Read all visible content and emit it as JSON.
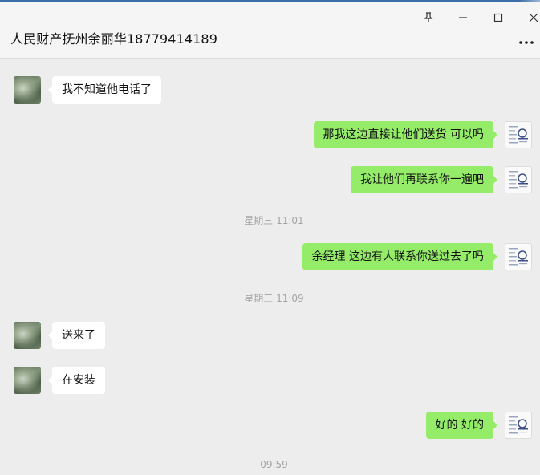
{
  "window": {
    "title": "人民财产抚州余丽华18779414189",
    "pin_icon": "pin-icon",
    "minimize_icon": "minimize-icon",
    "maximize_icon": "maximize-icon",
    "close_icon": "close-icon",
    "more_icon": "more-dots-icon"
  },
  "colors": {
    "outgoing_bubble": "#95ec69",
    "incoming_bubble": "#ffffff",
    "background": "#ededed",
    "timestamp": "#a3a3a3"
  },
  "messages": [
    {
      "direction": "in",
      "text": "我不知道他电话了"
    },
    {
      "direction": "out",
      "text": "那我这边直接让他们送货 可以吗"
    },
    {
      "direction": "out",
      "text": "我让他们再联系你一遍吧"
    },
    {
      "type": "time",
      "text": "星期三 11:01"
    },
    {
      "direction": "out",
      "text": "余经理  这边有人联系你送过去了吗"
    },
    {
      "type": "time",
      "text": "星期三 11:09"
    },
    {
      "direction": "in",
      "text": "送来了"
    },
    {
      "direction": "in",
      "text": "在安装"
    },
    {
      "direction": "out",
      "text": "好的 好的"
    },
    {
      "type": "time",
      "text": "09:59"
    }
  ]
}
